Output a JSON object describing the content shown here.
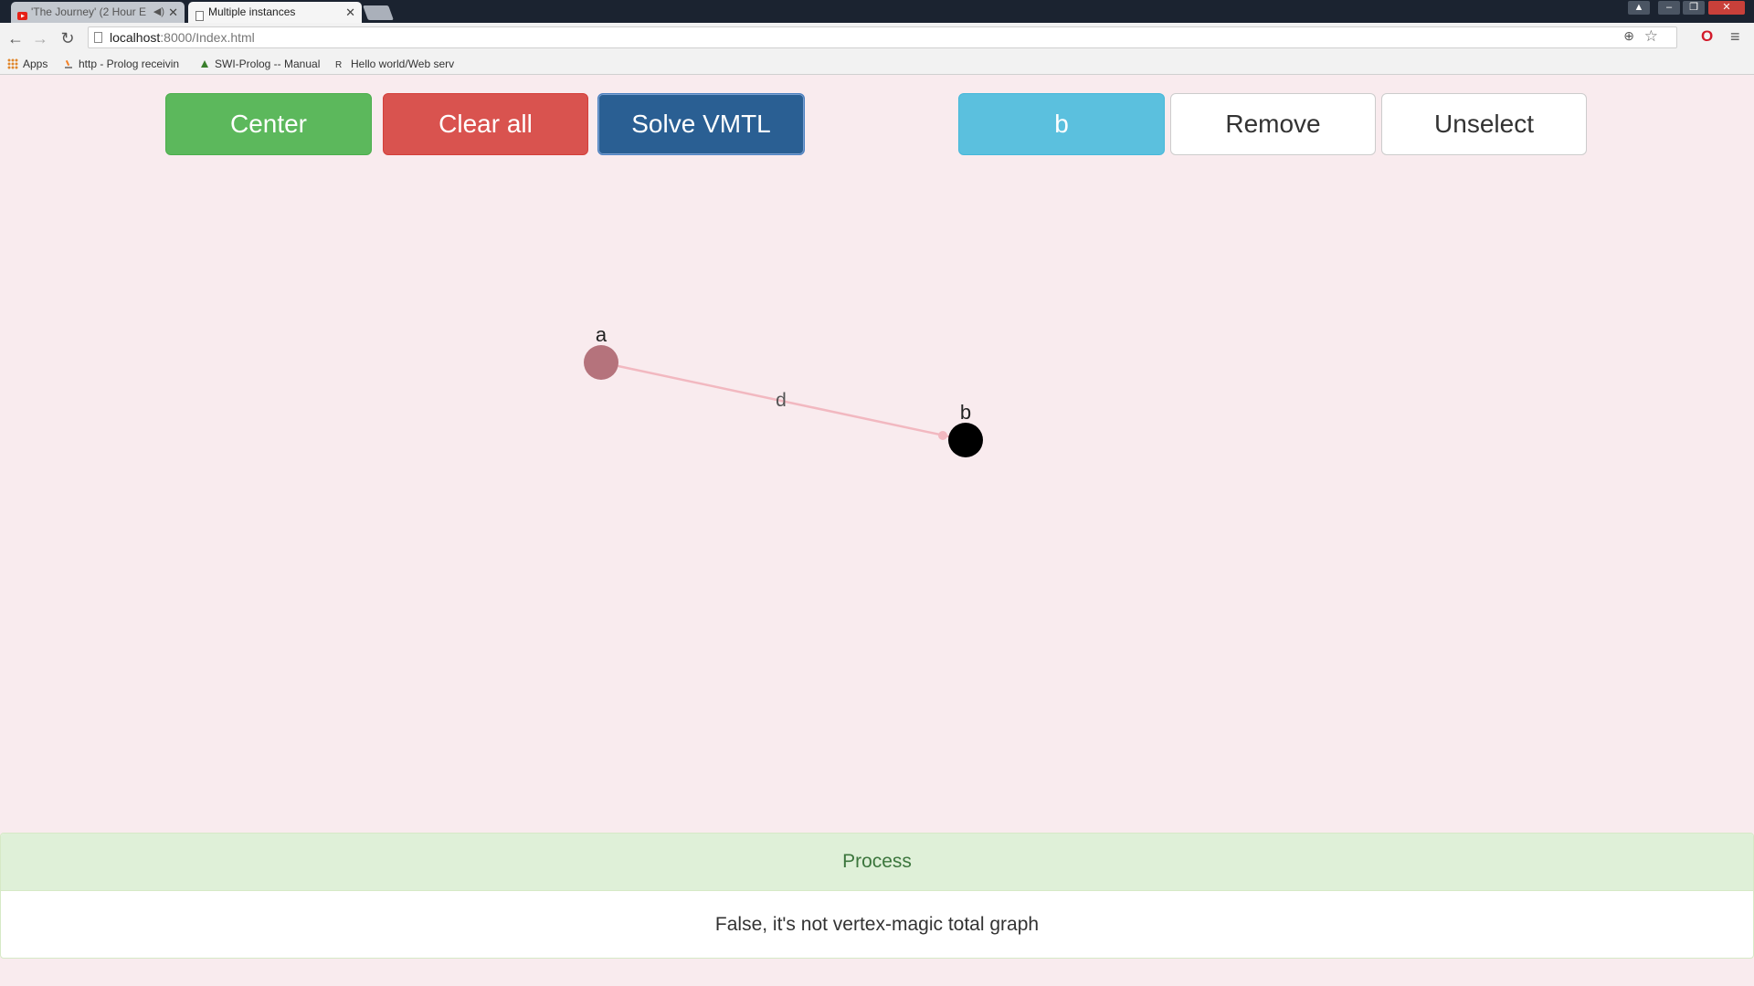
{
  "browser": {
    "tabs": [
      {
        "title": "'The Journey' (2 Hour E",
        "icon": "youtube-icon",
        "audio": true
      },
      {
        "title": "Multiple instances",
        "icon": "page-icon",
        "active": true
      }
    ],
    "url_host": "localhost",
    "url_rest": ":8000/Index.html",
    "bookmarks": [
      {
        "label": "Apps",
        "icon": "apps-grid-icon"
      },
      {
        "label": "http - Prolog receivin",
        "icon": "stackoverflow-icon"
      },
      {
        "label": "SWI-Prolog -- Manual",
        "icon": "swi-prolog-icon"
      },
      {
        "label": "Hello world/Web serv",
        "icon": "rosetta-code-icon"
      }
    ]
  },
  "toolbar": {
    "center_label": "Center",
    "clear_label": "Clear all",
    "solve_label": "Solve VMTL",
    "selected_label": "b",
    "remove_label": "Remove",
    "unselect_label": "Unselect"
  },
  "graph": {
    "nodes": [
      {
        "id": "a",
        "label": "a",
        "color": "#b5737c",
        "selected": false
      },
      {
        "id": "b",
        "label": "b",
        "color": "#000000",
        "selected": true
      }
    ],
    "edges": [
      {
        "from": "a",
        "to": "b",
        "label": "d",
        "color": "#f2b8c0"
      }
    ]
  },
  "process": {
    "heading": "Process",
    "result": "False, it's not vertex-magic total graph"
  },
  "colors": {
    "background": "#f9ebee",
    "success": "#5cb85c",
    "danger": "#d9534f",
    "primary": "#2a5f93",
    "info": "#5bc0de"
  }
}
